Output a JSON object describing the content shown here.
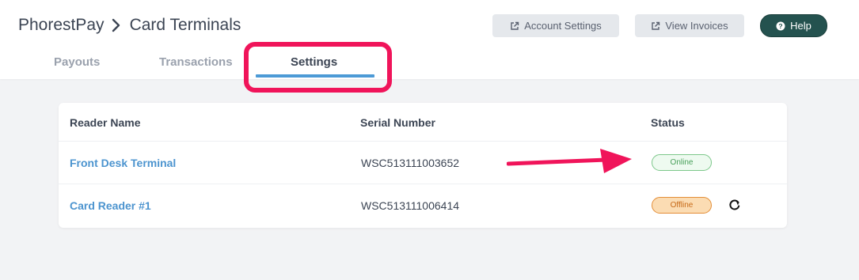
{
  "breadcrumb": {
    "root": "PhorestPay",
    "current": "Card Terminals"
  },
  "header_buttons": {
    "account_settings": "Account Settings",
    "view_invoices": "View Invoices",
    "help": "Help"
  },
  "tabs": [
    {
      "label": "Payouts",
      "active": false
    },
    {
      "label": "Transactions",
      "active": false
    },
    {
      "label": "Settings",
      "active": true
    }
  ],
  "table": {
    "columns": [
      "Reader Name",
      "Serial Number",
      "Status"
    ],
    "rows": [
      {
        "name": "Front Desk Terminal",
        "serial": "WSC513111003652",
        "status": "Online"
      },
      {
        "name": "Card Reader #1",
        "serial": "WSC513111006414",
        "status": "Offline"
      }
    ]
  },
  "colors": {
    "accent": "#4c9ad6",
    "help_button": "#24524f",
    "annotation": "#f0145a",
    "online": "#48a05a",
    "offline": "#c76a18"
  },
  "icons": {
    "breadcrumb_separator": "chevron-right-icon",
    "external": "external-link-icon",
    "help": "question-circle-icon",
    "refresh": "refresh-icon"
  }
}
